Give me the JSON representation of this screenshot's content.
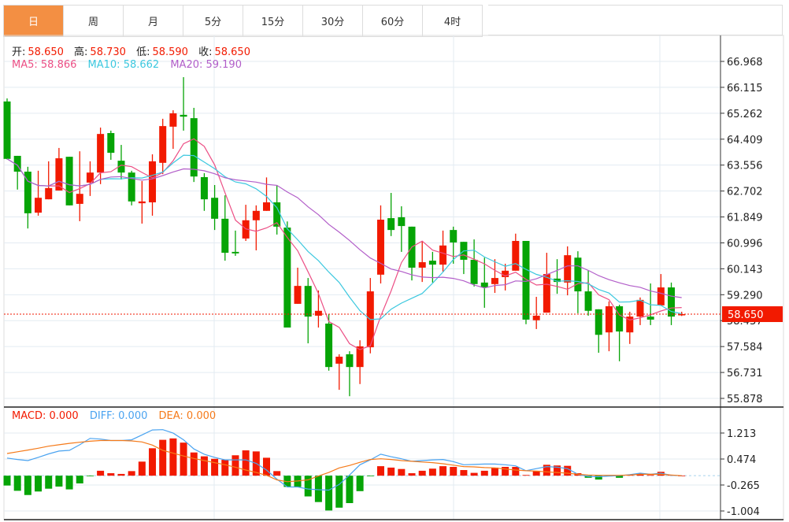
{
  "tabs": [
    {
      "label": "日",
      "active": true
    },
    {
      "label": "周"
    },
    {
      "label": "月"
    },
    {
      "label": "5分"
    },
    {
      "label": "15分"
    },
    {
      "label": "30分"
    },
    {
      "label": "60分"
    },
    {
      "label": "4时"
    }
  ],
  "ohlc_info": {
    "open_label": "开:",
    "open": "58.650",
    "high_label": "高:",
    "high": "58.730",
    "low_label": "低:",
    "low": "58.590",
    "close_label": "收:",
    "close": "58.650"
  },
  "ma_info": {
    "ma5": "MA5: 58.866",
    "ma10": "MA10: 58.662",
    "ma20": "MA20: 59.190"
  },
  "macd_info": {
    "macd": "MACD: 0.000",
    "diff": "DIFF: 0.000",
    "dea": "DEA: 0.000"
  },
  "current_price": "58.650",
  "colors": {
    "up": "#f21a00",
    "down": "#06a406",
    "ma5": "#ec4f85",
    "ma10": "#3cc8df",
    "ma20": "#b25ec9",
    "diff": "#4aa3f0",
    "dea": "#f57a1a",
    "active_tab": "#f38f43"
  },
  "chart_data": [
    {
      "type": "candlestick",
      "yticks": [
        "66.968",
        "66.115",
        "65.262",
        "64.409",
        "63.556",
        "62.702",
        "61.849",
        "60.996",
        "60.143",
        "59.290",
        "58.437",
        "57.584",
        "56.731",
        "55.878"
      ],
      "ylim": [
        55.878,
        66.968
      ],
      "candles": [
        [
          65.65,
          65.75,
          63.74,
          63.76
        ],
        [
          63.86,
          63.86,
          62.75,
          63.34
        ],
        [
          63.34,
          63.5,
          61.47,
          61.97
        ],
        [
          61.99,
          63.37,
          61.89,
          62.48
        ],
        [
          62.43,
          63.68,
          62.43,
          62.8
        ],
        [
          62.72,
          64.12,
          62.72,
          63.78
        ],
        [
          63.83,
          63.83,
          62.23,
          62.23
        ],
        [
          62.28,
          64.01,
          61.71,
          62.61
        ],
        [
          62.98,
          63.68,
          62.54,
          63.31
        ],
        [
          63.31,
          64.79,
          62.93,
          64.58
        ],
        [
          64.61,
          64.69,
          63.73,
          63.96
        ],
        [
          63.7,
          64.22,
          63.08,
          63.31
        ],
        [
          63.31,
          63.37,
          62.23,
          62.36
        ],
        [
          62.3,
          63.03,
          61.63,
          62.36
        ],
        [
          62.33,
          63.91,
          61.89,
          63.68
        ],
        [
          63.63,
          65.08,
          63.26,
          64.84
        ],
        [
          64.82,
          65.36,
          64.09,
          65.26
        ],
        [
          65.21,
          66.45,
          64.69,
          65.15
        ],
        [
          65.1,
          65.44,
          63.0,
          63.18
        ],
        [
          63.16,
          63.29,
          62.05,
          62.43
        ],
        [
          62.48,
          62.9,
          61.42,
          61.79
        ],
        [
          61.79,
          62.56,
          60.41,
          60.67
        ],
        [
          60.7,
          61.4,
          60.57,
          60.65
        ],
        [
          61.14,
          62.25,
          61.06,
          61.74
        ],
        [
          61.74,
          62.23,
          60.75,
          62.05
        ],
        [
          62.05,
          63.15,
          62.05,
          62.33
        ],
        [
          62.33,
          62.9,
          61.27,
          61.53
        ],
        [
          61.5,
          61.7,
          58.21,
          58.21
        ],
        [
          58.99,
          60.18,
          58.99,
          59.58
        ],
        [
          59.58,
          59.84,
          57.69,
          58.57
        ],
        [
          58.6,
          59.43,
          58.21,
          58.76
        ],
        [
          58.34,
          58.65,
          56.79,
          56.91
        ],
        [
          57.02,
          57.33,
          56.16,
          57.25
        ],
        [
          57.33,
          57.43,
          55.95,
          56.91
        ],
        [
          56.91,
          57.79,
          56.35,
          57.59
        ],
        [
          57.56,
          59.84,
          57.36,
          59.4
        ],
        [
          59.95,
          62.23,
          59.66,
          61.76
        ],
        [
          61.81,
          62.64,
          61.22,
          61.42
        ],
        [
          61.84,
          62.2,
          60.7,
          61.55
        ],
        [
          61.53,
          61.53,
          59.76,
          60.18
        ],
        [
          60.18,
          61.06,
          59.71,
          60.36
        ],
        [
          60.41,
          60.7,
          59.69,
          60.28
        ],
        [
          60.28,
          61.4,
          60.05,
          60.91
        ],
        [
          61.42,
          61.53,
          60.31,
          61.01
        ],
        [
          61.03,
          61.03,
          59.97,
          60.44
        ],
        [
          60.44,
          61.11,
          59.56,
          59.64
        ],
        [
          59.69,
          60.51,
          58.86,
          59.53
        ],
        [
          59.64,
          60.46,
          59.35,
          59.84
        ],
        [
          59.87,
          60.31,
          59.43,
          60.08
        ],
        [
          60.08,
          61.3,
          60.08,
          61.06
        ],
        [
          61.06,
          61.06,
          58.32,
          58.47
        ],
        [
          58.45,
          59.22,
          58.16,
          58.6
        ],
        [
          58.7,
          60.67,
          58.7,
          59.97
        ],
        [
          59.82,
          60.46,
          59.32,
          59.71
        ],
        [
          59.69,
          60.88,
          59.27,
          60.59
        ],
        [
          60.51,
          60.72,
          58.68,
          59.4
        ],
        [
          59.4,
          60.1,
          58.6,
          58.76
        ],
        [
          58.81,
          58.81,
          57.38,
          57.97
        ],
        [
          58.05,
          59.07,
          57.43,
          58.91
        ],
        [
          58.91,
          58.96,
          57.1,
          58.08
        ],
        [
          58.05,
          58.73,
          57.67,
          58.57
        ],
        [
          58.57,
          59.2,
          58.29,
          59.12
        ],
        [
          58.57,
          59.66,
          58.29,
          58.47
        ],
        [
          58.94,
          59.97,
          58.94,
          59.53
        ],
        [
          59.53,
          59.69,
          58.29,
          58.57
        ],
        [
          58.65,
          58.73,
          58.59,
          58.65
        ]
      ],
      "candle_format": [
        "open",
        "high",
        "low",
        "close"
      ],
      "ma_periods": [
        5,
        10,
        20
      ]
    },
    {
      "type": "macd",
      "yticks": [
        "1.213",
        "0.474",
        "-0.265",
        "-1.004"
      ],
      "ylim": [
        -1.004,
        1.213
      ],
      "macd": [
        -0.28,
        -0.43,
        -0.55,
        -0.45,
        -0.37,
        -0.31,
        -0.39,
        -0.22,
        -0.01,
        0.14,
        0.07,
        0.05,
        0.13,
        0.4,
        0.78,
        1.02,
        1.06,
        0.94,
        0.66,
        0.55,
        0.48,
        0.45,
        0.58,
        0.72,
        0.69,
        0.51,
        0.13,
        -0.32,
        -0.32,
        -0.59,
        -0.75,
        -0.99,
        -0.91,
        -0.78,
        -0.44,
        -0.01,
        0.27,
        0.23,
        0.19,
        0.07,
        0.14,
        0.2,
        0.27,
        0.25,
        0.16,
        0.08,
        0.14,
        0.23,
        0.25,
        0.25,
        0.02,
        0.14,
        0.31,
        0.29,
        0.28,
        0.07,
        -0.06,
        -0.11,
        -0.02,
        -0.06,
        0.02,
        0.06,
        0.02,
        0.11,
        0.02,
        0.0
      ],
      "diff": [
        0.5,
        0.46,
        0.43,
        0.52,
        0.62,
        0.7,
        0.72,
        0.88,
        1.06,
        1.04,
        1.0,
        1.0,
        1.02,
        1.16,
        1.3,
        1.31,
        1.21,
        1.02,
        0.76,
        0.61,
        0.52,
        0.45,
        0.45,
        0.45,
        0.35,
        0.16,
        -0.1,
        -0.32,
        -0.32,
        -0.38,
        -0.4,
        -0.41,
        -0.25,
        0.02,
        0.31,
        0.45,
        0.61,
        0.54,
        0.48,
        0.41,
        0.43,
        0.45,
        0.46,
        0.4,
        0.31,
        0.32,
        0.33,
        0.33,
        0.31,
        0.28,
        0.14,
        0.2,
        0.26,
        0.24,
        0.2,
        0.04,
        -0.02,
        -0.03,
        -0.01,
        0.0,
        0.03,
        0.07,
        0.04,
        0.07,
        0.01,
        0.0
      ],
      "dea": [
        0.63,
        0.68,
        0.73,
        0.78,
        0.84,
        0.88,
        0.92,
        0.95,
        0.98,
        1.0,
        1.0,
        1.0,
        0.99,
        0.96,
        0.87,
        0.72,
        0.64,
        0.56,
        0.49,
        0.43,
        0.37,
        0.31,
        0.24,
        0.16,
        0.09,
        0.01,
        -0.12,
        -0.17,
        -0.15,
        -0.12,
        -0.01,
        0.09,
        0.22,
        0.29,
        0.38,
        0.46,
        0.48,
        0.46,
        0.43,
        0.41,
        0.39,
        0.37,
        0.34,
        0.3,
        0.26,
        0.25,
        0.23,
        0.22,
        0.19,
        0.16,
        0.14,
        0.13,
        0.11,
        0.09,
        0.07,
        0.04,
        0.02,
        0.01,
        0.01,
        0.01,
        0.02,
        0.04,
        0.04,
        0.04,
        0.02,
        0.0
      ]
    }
  ]
}
